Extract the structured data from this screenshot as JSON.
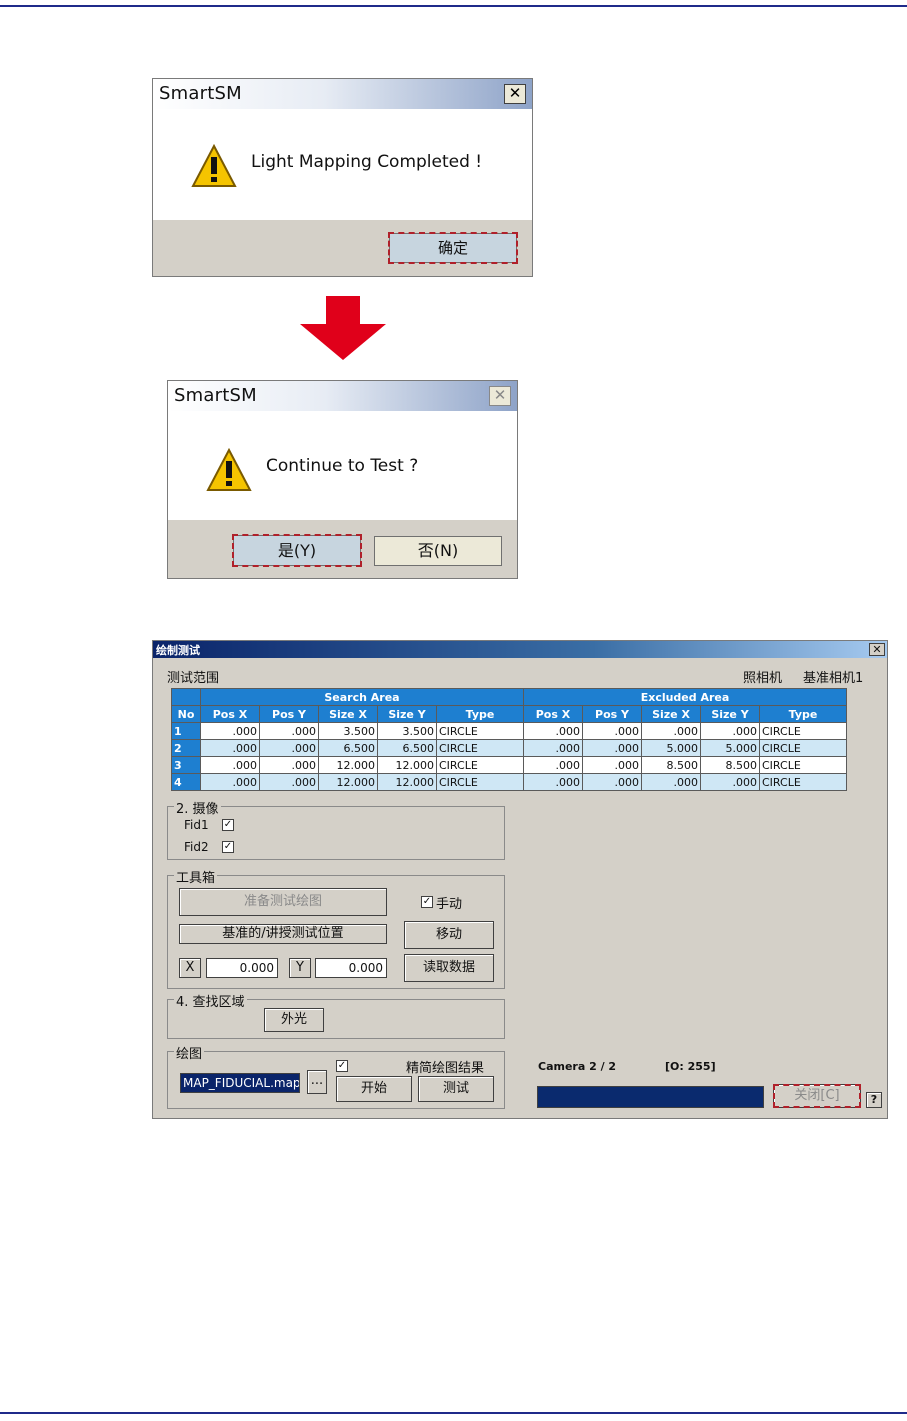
{
  "dialog1": {
    "title": "SmartSM",
    "close_glyph": "✕",
    "message": "Light Mapping Completed !",
    "icon": "warning-icon",
    "ok_label": "确定"
  },
  "arrow": {
    "color": "#e0001a",
    "icon": "down-arrow-icon"
  },
  "dialog2": {
    "title": "SmartSM",
    "close_glyph": "✕",
    "message": "Continue to Test ?",
    "icon": "warning-icon",
    "yes_label": "是(Y)",
    "no_label": "否(N)"
  },
  "main": {
    "title": "绘制测试",
    "close_glyph": "✕",
    "section_label": "测试范围",
    "camera_label": "照相机",
    "camera_value": "基准相机1",
    "table": {
      "group_search": "Search Area",
      "group_excluded": "Excluded Area",
      "headers": [
        "No",
        "Pos X",
        "Pos Y",
        "Size X",
        "Size Y",
        "Type",
        "Pos X",
        "Pos Y",
        "Size X",
        "Size Y",
        "Type"
      ],
      "rows": [
        [
          "1",
          ".000",
          ".000",
          "3.500",
          "3.500",
          "CIRCLE",
          ".000",
          ".000",
          ".000",
          ".000",
          "CIRCLE"
        ],
        [
          "2",
          ".000",
          ".000",
          "6.500",
          "6.500",
          "CIRCLE",
          ".000",
          ".000",
          "5.000",
          "5.000",
          "CIRCLE"
        ],
        [
          "3",
          ".000",
          ".000",
          "12.000",
          "12.000",
          "CIRCLE",
          ".000",
          ".000",
          "8.500",
          "8.500",
          "CIRCLE"
        ],
        [
          "4",
          ".000",
          ".000",
          "12.000",
          "12.000",
          "CIRCLE",
          ".000",
          ".000",
          ".000",
          ".000",
          "CIRCLE"
        ]
      ]
    },
    "camera_group": {
      "title": "2. 摄像",
      "fid1": "Fid1",
      "fid2": "Fid2",
      "check": "✓"
    },
    "toolbox": {
      "title": "工具箱",
      "prepare_label": "准备测试绘图",
      "manual_label": "手动",
      "position_label": "基准的/讲授测试位置",
      "move_label": "移动",
      "x_label": "X",
      "x_value": "0.000",
      "y_label": "Y",
      "y_value": "0.000",
      "read_label": "读取数据"
    },
    "search_group": {
      "title": "4. 查找区域",
      "external_light_label": "外光"
    },
    "draw_group": {
      "title": "绘图",
      "map_file": "MAP_FIDUCIAL.map",
      "browse_label": "...",
      "simplify_label": "精简绘图结果",
      "start_label": "开始",
      "test_label": "测试"
    },
    "camera_status": "Camera 2 / 2",
    "value_status": "[O:  255]",
    "close_label": "关闭[C]",
    "help_label": "?",
    "progress_color": "#0a2a6e"
  }
}
